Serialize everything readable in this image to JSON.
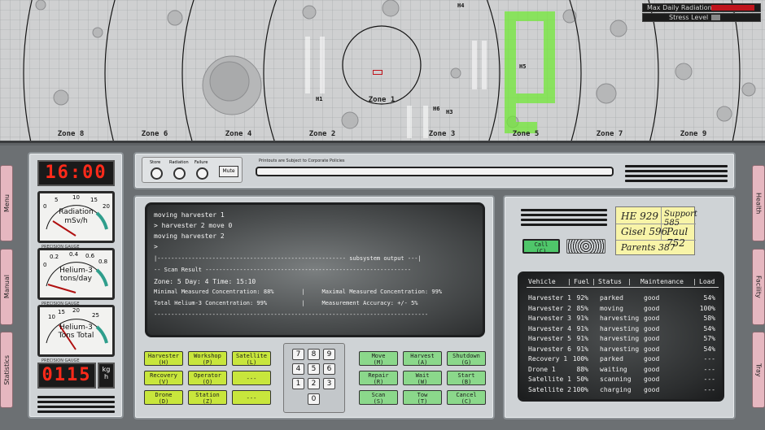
{
  "map": {
    "zones": [
      "Zone 8",
      "Zone 6",
      "Zone 4",
      "Zone 2",
      "Zone 1",
      "Zone 3",
      "Zone 5",
      "Zone 7",
      "Zone 9"
    ],
    "markers": [
      "H4",
      "H1",
      "H6",
      "H3",
      "H5"
    ],
    "radiation_label": "Max Daily Radiation",
    "stress_label": "Stress Level",
    "radiation_color": "#c0141c",
    "radiation_level": 0.95,
    "stress_level": 0.2
  },
  "sidebar_left": [
    "Menu",
    "Manual",
    "Statistics"
  ],
  "sidebar_right": [
    "Health",
    "Facility",
    "Tray"
  ],
  "clock": "16:00",
  "gauges": [
    {
      "title": "Radiation",
      "unit": "mSv/h",
      "ticks": [
        "0",
        "5",
        "10",
        "15",
        "20"
      ],
      "caption": "PRECISION GAUGE"
    },
    {
      "title": "Helium-3",
      "unit": "tons/day",
      "ticks": [
        "0",
        "0.2",
        "0.4",
        "0.6",
        "0.8"
      ],
      "caption": "PRECISION GAUGE"
    },
    {
      "title": "Helium-3",
      "unit": "Tons Total",
      "ticks": [
        "10",
        "15",
        "20",
        "25"
      ],
      "caption": "PRECISION GAUGE"
    }
  ],
  "rate": {
    "value": "0115",
    "unit_top": "kg",
    "unit_bottom": "h"
  },
  "alarms": {
    "store": "Store",
    "radiation": "Radiation",
    "failure": "Failure",
    "mute": "Mute"
  },
  "printout_label": "Printouts are Subject to Corporate Policies",
  "terminal": [
    "moving harvester 1",
    "> harvester 2 move 0",
    "moving harvester 2",
    ">",
    "|------------------------------------------------------- subsystem output ---|",
    "-- Scan Result ------------------------------------------------------------",
    "Zone: 5 Day: 4 Time: 15:10",
    "Minimal Measured Concentration: 88%        |     Maximal Measured Concentration: 99%",
    "Total Helium-3 Concentration: 99%          |     Measurement Accuracy: +/- 5%",
    "--------------------------------------------------------------------------------"
  ],
  "left_buttons": [
    {
      "label": "Harvester",
      "key": "(H)"
    },
    {
      "label": "Workshop",
      "key": "(P)"
    },
    {
      "label": "Satellite",
      "key": "(L)"
    },
    {
      "label": "Recovery",
      "key": "(V)"
    },
    {
      "label": "Operator",
      "key": "(O)"
    },
    {
      "label": "---",
      "key": ""
    },
    {
      "label": "Drone",
      "key": "(D)"
    },
    {
      "label": "Station",
      "key": "(Z)"
    },
    {
      "label": "---",
      "key": ""
    }
  ],
  "keypad": [
    "7",
    "8",
    "9",
    "4",
    "5",
    "6",
    "1",
    "2",
    "3",
    "0"
  ],
  "right_buttons": [
    {
      "label": "Move",
      "key": "(M)"
    },
    {
      "label": "Harvest",
      "key": "(A)"
    },
    {
      "label": "Shutdown",
      "key": "(G)"
    },
    {
      "label": "Repair",
      "key": "(R)"
    },
    {
      "label": "Wait",
      "key": "(W)"
    },
    {
      "label": "Start",
      "key": "(B)"
    },
    {
      "label": "Scan",
      "key": "(S)"
    },
    {
      "label": "Tow",
      "key": "(T)"
    },
    {
      "label": "Cancel",
      "key": "(C)"
    }
  ],
  "call_button": {
    "label": "Call",
    "key": "(C)"
  },
  "contacts": [
    {
      "name": "HE",
      "number": "929"
    },
    {
      "name": "Support",
      "number": "585"
    },
    {
      "name": "Gisel",
      "number": "596"
    },
    {
      "name": "Paul",
      "number": "752"
    },
    {
      "name": "Parents",
      "number": "387"
    }
  ],
  "vehicle_table": {
    "headers": [
      "Vehicle",
      "Fuel",
      "Status",
      "Maintenance",
      "Load"
    ],
    "rows": [
      [
        "Harvester 1",
        "92%",
        "parked",
        "good",
        "54%"
      ],
      [
        "Harvester 2",
        "85%",
        "moving",
        "good",
        "100%"
      ],
      [
        "Harvester 3",
        "91%",
        "harvesting",
        "good",
        "58%"
      ],
      [
        "Harvester 4",
        "91%",
        "harvesting",
        "good",
        "54%"
      ],
      [
        "Harvester 5",
        "91%",
        "harvesting",
        "good",
        "57%"
      ],
      [
        "Harvester 6",
        "91%",
        "harvesting",
        "good",
        "54%"
      ],
      [
        "Recovery 1",
        "100%",
        "parked",
        "good",
        "---"
      ],
      [
        "Drone 1",
        "88%",
        "waiting",
        "good",
        "---"
      ],
      [
        "Satellite 1",
        "50%",
        "scanning",
        "good",
        "---"
      ],
      [
        "Satellite 2",
        "100%",
        "charging",
        "good",
        "---"
      ]
    ]
  }
}
